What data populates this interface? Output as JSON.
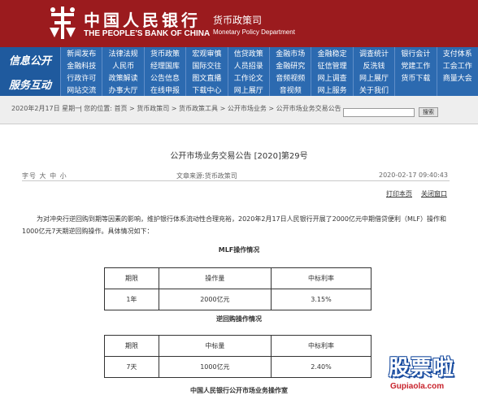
{
  "header": {
    "title_cn": "中国人民银行",
    "title_en": "THE PEOPLE'S BANK OF CHINA",
    "dept_cn": "货币政策司",
    "dept_en": "Monetary Policy Department",
    "bg_color": "#9b1b1e"
  },
  "nav": {
    "section1": "信息公开",
    "section2": "服务互动",
    "row1": [
      "新闻发布",
      "法律法规",
      "货币政策",
      "宏观审慎",
      "信贷政策",
      "金融市场",
      "金融稳定",
      "调查统计",
      "银行会计",
      "支付体系"
    ],
    "row2": [
      "金融科技",
      "人民币",
      "经理国库",
      "国际交往",
      "人员招录",
      "金融研究",
      "征信管理",
      "反洗钱",
      "党建工作",
      "工会工作"
    ],
    "row3": [
      "行政许可",
      "政策解读",
      "公告信息",
      "图文直播",
      "工作论文",
      "音频视频",
      "网上调查",
      "网上展厅",
      "货币下载",
      "商量大会"
    ],
    "row4": [
      "网站交流",
      "办事大厅",
      "在线申报",
      "下载中心",
      "网上展厅",
      "音视频",
      "网上服务",
      "关于我们",
      "",
      ""
    ]
  },
  "breadcrumb": {
    "date": "2020年2月17日 星期一",
    "path": "| 您的位置: 首页 > 货币政策司 > 货币政策工具 > 公开市场业务 > 公开市场业务交易公告",
    "search_button": "搜索"
  },
  "article": {
    "title": "公开市场业务交易公告 [2020]第29号",
    "font_size_label": "字号  大 中 小",
    "source": "文章来源:货币政策司",
    "timestamp": "2020-02-17 09:40:43",
    "print": "打印本页",
    "close": "关闭窗口",
    "paragraph": "为对冲央行逆回购到期等因素的影响，维护银行体系流动性合理充裕，2020年2月17日人民银行开展了2000亿元中期借贷便利（MLF）操作和1000亿元7天期逆回购操作。具体情况如下：",
    "mlf_heading": "MLF操作情况",
    "repo_heading": "逆回购操作情况",
    "footer": "中国人民银行公开市场业务操作室"
  },
  "mlf_table": {
    "headers": [
      "期限",
      "操作量",
      "中标利率"
    ],
    "rows": [
      [
        "1年",
        "2000亿元",
        "3.15%"
      ]
    ]
  },
  "repo_table": {
    "headers": [
      "期限",
      "中标量",
      "中标利率"
    ],
    "rows": [
      [
        "7天",
        "1000亿元",
        "2.40%"
      ]
    ]
  },
  "watermark": {
    "cn": "股票啦",
    "en": "Gupiaola.com"
  }
}
